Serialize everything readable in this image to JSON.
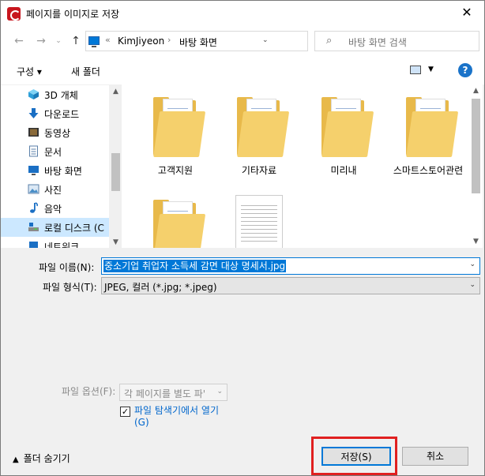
{
  "window": {
    "title": "페이지를 이미지로 저장",
    "close_glyph": "✕"
  },
  "address": {
    "overflow": "«",
    "crumbs": [
      "KimJiyeon",
      "바탕 화면"
    ],
    "separator": "›"
  },
  "search": {
    "placeholder": "바탕 화면 검색"
  },
  "toolbar": {
    "organize": "구성 ▾",
    "new_folder": "새 폴더",
    "help": "?"
  },
  "nav_pane": {
    "items": [
      {
        "label": "3D 개체",
        "icon": "3d-objects-icon"
      },
      {
        "label": "다운로드",
        "icon": "download-icon"
      },
      {
        "label": "동영상",
        "icon": "video-icon"
      },
      {
        "label": "문서",
        "icon": "document-icon"
      },
      {
        "label": "바탕 화면",
        "icon": "desktop-icon"
      },
      {
        "label": "사진",
        "icon": "pictures-icon"
      },
      {
        "label": "음악",
        "icon": "music-icon"
      },
      {
        "label": "로컬 디스크 (C",
        "icon": "drive-icon",
        "selected": true
      },
      {
        "label": "네트워크",
        "icon": "network-icon"
      }
    ]
  },
  "files": [
    {
      "name": "고객지원",
      "type": "folder"
    },
    {
      "name": "기타자료",
      "type": "folder"
    },
    {
      "name": "미리내",
      "type": "folder"
    },
    {
      "name": "스마트스토어관련",
      "type": "folder"
    },
    {
      "name": "",
      "type": "folder"
    },
    {
      "name": "",
      "type": "document"
    }
  ],
  "form": {
    "filename_label": "파일 이름(N):",
    "filename_value": "중소기업 취업자 소득세 감면 대상 명세서.jpg",
    "filetype_label": "파일 형식(T):",
    "filetype_value": "JPEG, 컬러 (*.jpg; *.jpeg)",
    "option_label": "파일 옵션(F):",
    "option_value": "각 페이지를 별도 파'",
    "open_in_explorer_label": "파일 탐색기에서 열기 (G)",
    "open_in_explorer_checked": true
  },
  "footer": {
    "hide_folders": "폴더 숨기기",
    "save": "저장(S)",
    "cancel": "취소"
  },
  "colors": {
    "accent": "#0078d7",
    "highlight": "#e02020",
    "app_icon": "#c8161e"
  }
}
